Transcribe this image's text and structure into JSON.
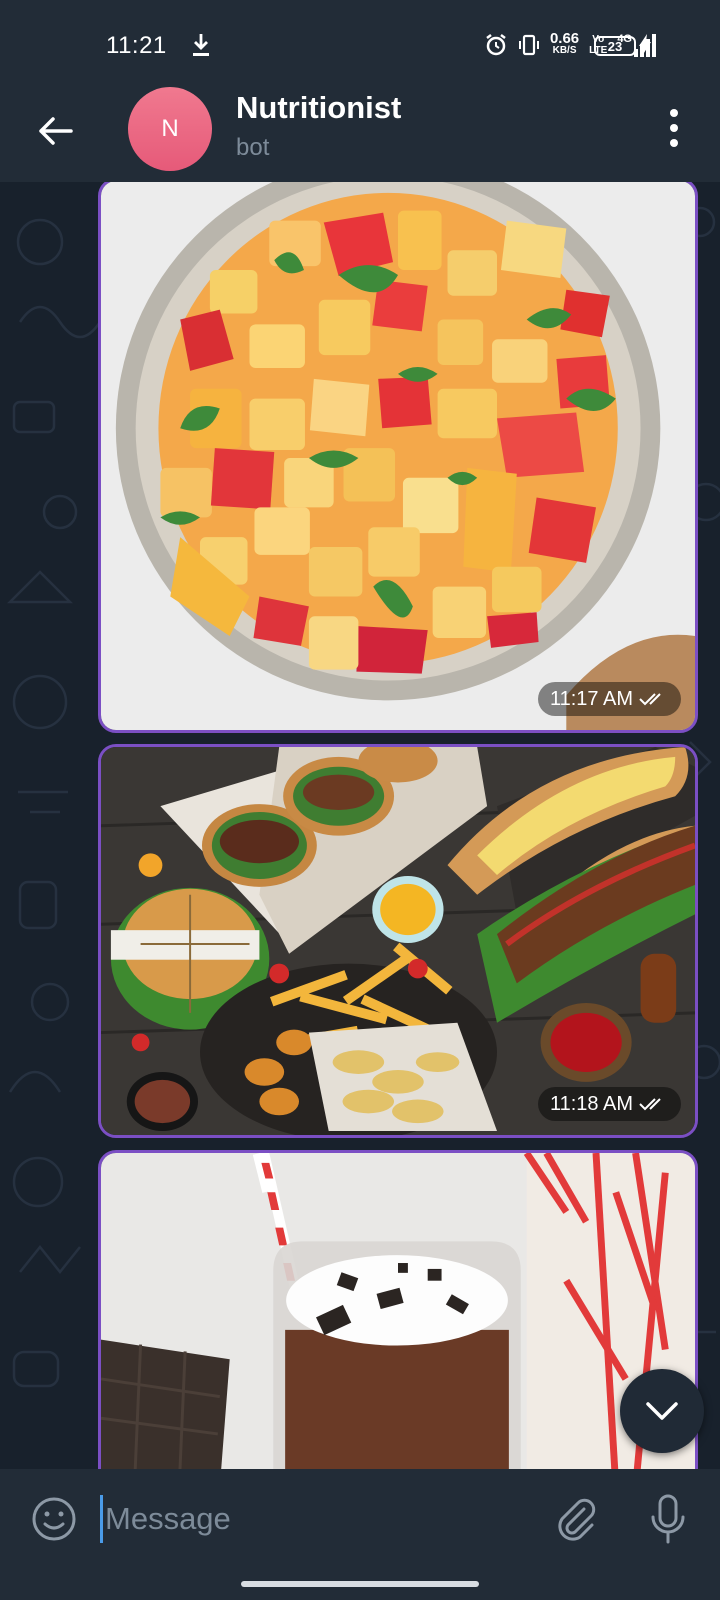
{
  "status_bar": {
    "time": "11:21",
    "net_speed_value": "0.66",
    "net_speed_unit": "KB/S",
    "volte_top": "Vo",
    "volte_bottom": "LTE",
    "network_type": "4G",
    "battery_level": "23"
  },
  "header": {
    "avatar_initial": "N",
    "title": "Nutritionist",
    "subtitle": "bot"
  },
  "messages": [
    {
      "type": "photo",
      "subject": "fruit-salad-bowl",
      "time": "11:17 AM",
      "status": "read"
    },
    {
      "type": "photo",
      "subject": "fast-food-spread",
      "time": "11:18 AM",
      "status": "read"
    },
    {
      "type": "photo",
      "subject": "chocolate-milkshake",
      "time": "",
      "status": ""
    }
  ],
  "composer": {
    "placeholder": "Message"
  },
  "colors": {
    "bubble_border": "#7b4fc4",
    "avatar": "#ea6a86",
    "background": "#18212c",
    "header": "#222c37"
  }
}
